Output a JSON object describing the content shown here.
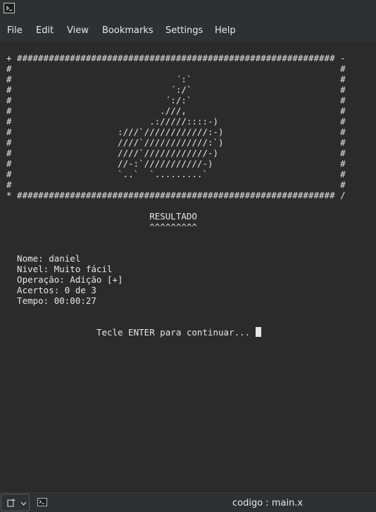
{
  "menu": {
    "items": [
      "File",
      "Edit",
      "View",
      "Bookmarks",
      "Settings",
      "Help"
    ]
  },
  "terminal": {
    "lines": [
      "+ ############################################################ -",
      "#                                                              #",
      "#                               ´:`                            #",
      "#                              ´:/`                            #",
      "#                             ´:/:`                            #",
      "#                            .///,                             #",
      "#                          .://///::::-)                       #",
      "#                    :///`////////////:-)                      #",
      "#                    ////`////////////:`)                      #",
      "#                    ////`////////////-)                       #",
      "#                    //-:`///////////-)                        #",
      "#                    `..`  `.........`                         #",
      "#                                                              #",
      "* ############################################################ /",
      "",
      "                           RESULTADO",
      "                           ^^^^^^^^^",
      "",
      "",
      "  Nome: daniel",
      "  Nivel: Muito fácil",
      "  Operação: Adição [+]",
      "  Acertos: 0 de 3",
      "  Tempo: 00:00:27",
      "",
      "",
      "                 Tecle ENTER para continuar... "
    ]
  },
  "taskbar": {
    "tab_title": "codigo : main.x"
  },
  "icons": {
    "app": "terminal-icon",
    "new_tab": "new-tab-icon",
    "dropdown": "chevron-down-icon",
    "tab": "terminal-icon"
  }
}
